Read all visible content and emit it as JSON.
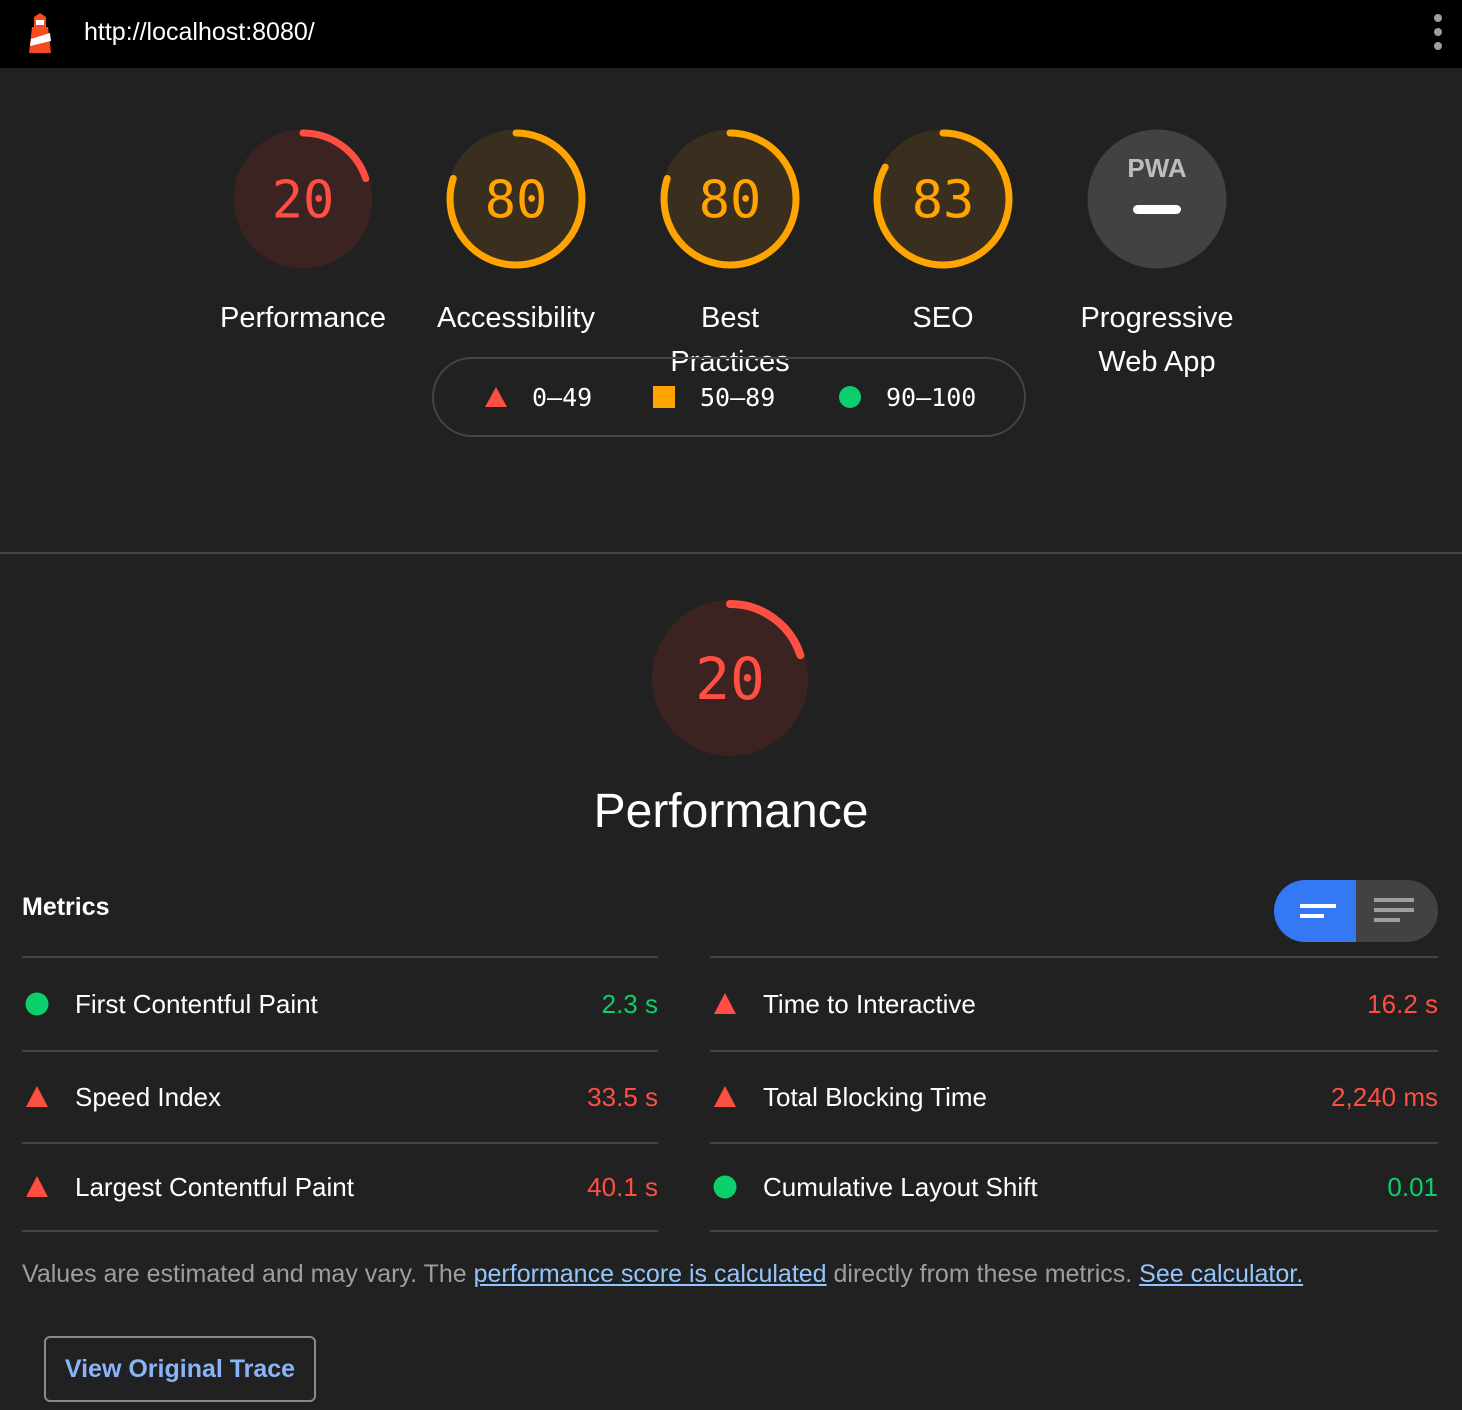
{
  "topbar": {
    "url": "http://localhost:8080/"
  },
  "colors": {
    "fail": "#ff4e42",
    "average": "#ffa400",
    "pass": "#0cce6b",
    "accent": "#3478f6"
  },
  "categories": [
    {
      "label_lines": [
        "Performance"
      ],
      "score": "20",
      "status": "fail"
    },
    {
      "label_lines": [
        "Accessibility"
      ],
      "score": "80",
      "status": "average"
    },
    {
      "label_lines": [
        "Best",
        "Practices"
      ],
      "score": "80",
      "status": "average"
    },
    {
      "label_lines": [
        "SEO"
      ],
      "score": "83",
      "status": "average"
    },
    {
      "label_lines": [
        "Progressive",
        "Web App"
      ],
      "score": "",
      "status": "pwa",
      "badge_text": "PWA"
    }
  ],
  "legend": [
    {
      "range": "0–49",
      "shape": "triangle",
      "status": "fail"
    },
    {
      "range": "50–89",
      "shape": "square",
      "status": "average"
    },
    {
      "range": "90–100",
      "shape": "circle",
      "status": "pass"
    }
  ],
  "performance_section": {
    "score": "20",
    "title": "Performance",
    "metrics_heading": "Metrics",
    "metrics_left": [
      {
        "name": "First Contentful Paint",
        "value": "2.3 s",
        "status": "pass"
      },
      {
        "name": "Speed Index",
        "value": "33.5 s",
        "status": "fail"
      },
      {
        "name": "Largest Contentful Paint",
        "value": "40.1 s",
        "status": "fail"
      }
    ],
    "metrics_right": [
      {
        "name": "Time to Interactive",
        "value": "16.2 s",
        "status": "fail"
      },
      {
        "name": "Total Blocking Time",
        "value": "2,240 ms",
        "status": "fail"
      },
      {
        "name": "Cumulative Layout Shift",
        "value": "0.01",
        "status": "pass"
      }
    ],
    "footnote": {
      "prefix": "Values are estimated and may vary. The ",
      "link1": "performance score is calculated",
      "middle": " directly from these metrics.",
      "link2": "See calculator."
    },
    "trace_button": "View Original Trace"
  }
}
